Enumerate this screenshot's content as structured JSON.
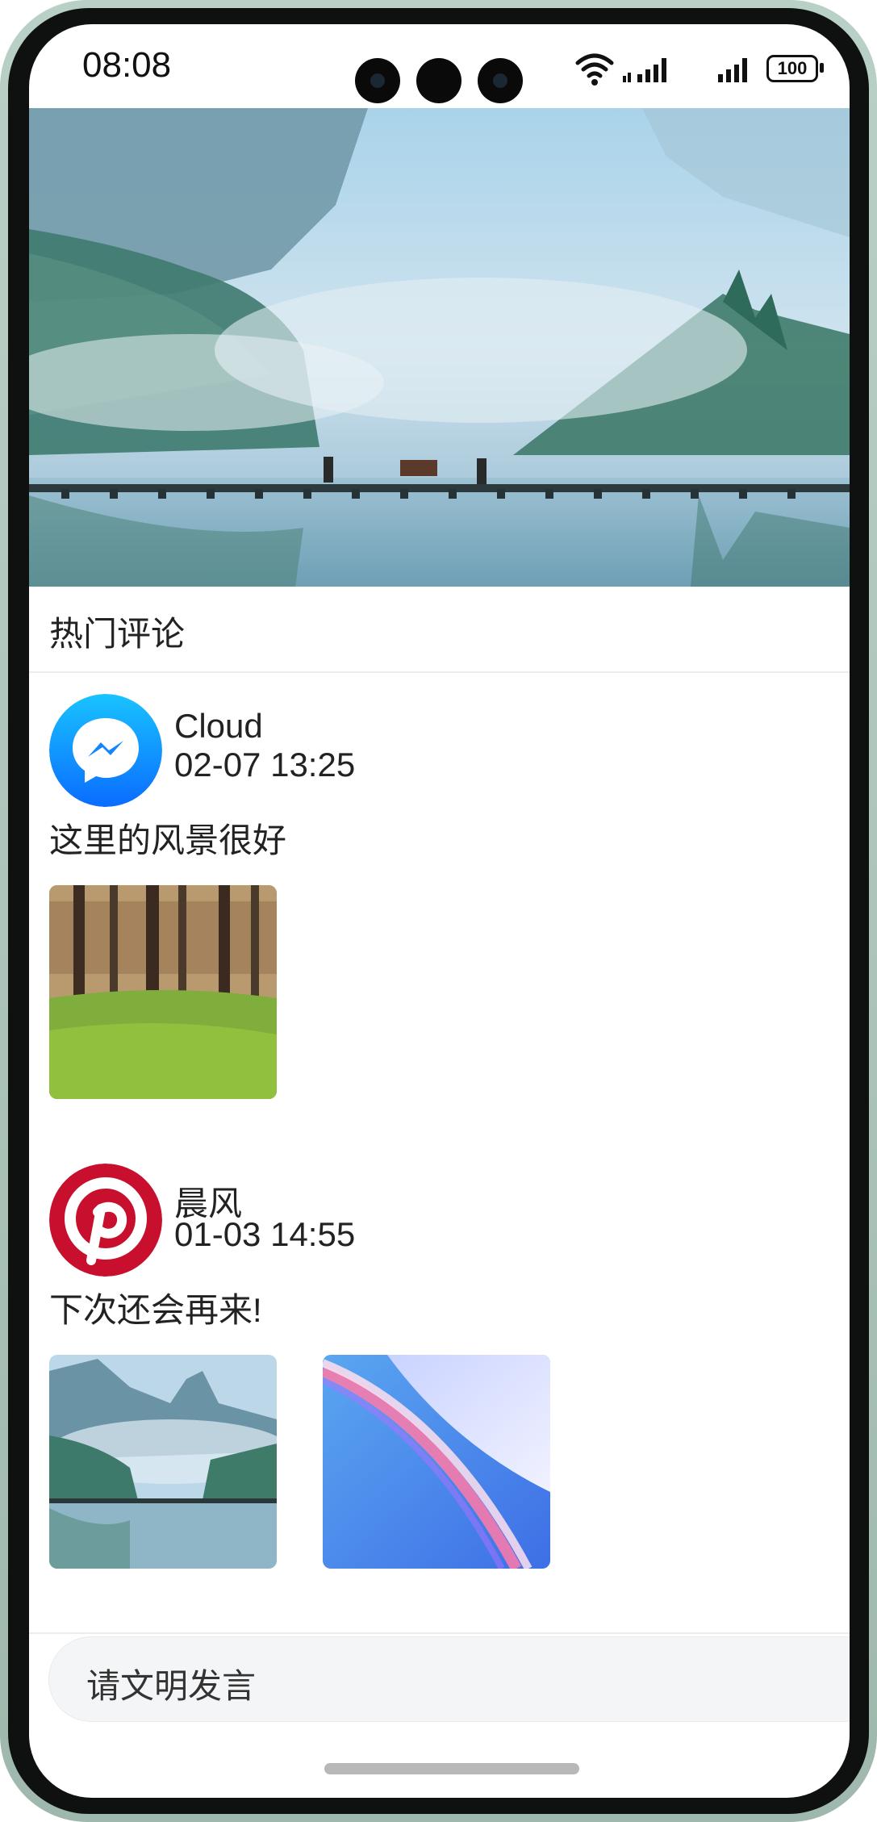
{
  "status_bar": {
    "time": "08:08",
    "battery": "100"
  },
  "comments_section": {
    "title": "热门评论"
  },
  "comments": [
    {
      "user": "Cloud",
      "date": "02-07 13:25",
      "text": "这里的风景很好",
      "avatar_icon": "messenger-icon",
      "images": [
        "forest-photo"
      ]
    },
    {
      "user": "晨风",
      "date": "01-03 14:55",
      "text": "下次还会再来!",
      "avatar_icon": "pinterest-icon",
      "images": [
        "misty-lake-photo",
        "abstract-wallpaper"
      ]
    }
  ],
  "input": {
    "placeholder": "请文明发言"
  },
  "colors": {
    "messenger_blue": "#0a84ff",
    "pinterest_red": "#c8102e",
    "background": "#ffffff"
  }
}
